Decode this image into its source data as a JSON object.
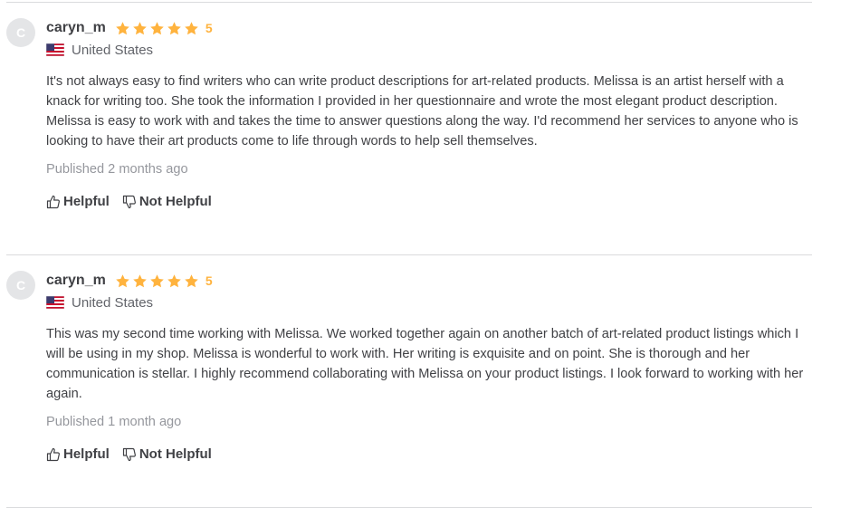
{
  "reviews": [
    {
      "avatar_initial": "C",
      "username": "caryn_m",
      "stars": 5,
      "rating": "5",
      "flag_icon": "us-flag-icon",
      "country": "United States",
      "text": "It's not always easy to find writers who can write product descriptions for art-related products. Melissa is an artist herself with a knack for writing too. She took the information I provided in her questionnaire and wrote the most elegant product description. Melissa is easy to work with and takes the time to answer questions along the way. I'd recommend her services to anyone who is looking to have their art products come to life through words to help sell themselves.",
      "published": "Published 2 months ago",
      "helpful_label": "Helpful",
      "not_helpful_label": "Not Helpful"
    },
    {
      "avatar_initial": "C",
      "username": "caryn_m",
      "stars": 5,
      "rating": "5",
      "flag_icon": "us-flag-icon",
      "country": "United States",
      "text": "This was my second time working with Melissa. We worked together again on another batch of art-related product listings which I will be using in my shop. Melissa is wonderful to work with. Her writing is exquisite and on point. She is thorough and her communication is stellar. I highly recommend collaborating with Melissa on your product listings. I look forward to working with her again.",
      "published": "Published 1 month ago",
      "helpful_label": "Helpful",
      "not_helpful_label": "Not Helpful"
    }
  ],
  "colors": {
    "star": "#ffb33e",
    "text": "#404145",
    "muted": "#95979d",
    "divider": "#dadbdd",
    "avatar_bg": "#e4e5e7"
  }
}
